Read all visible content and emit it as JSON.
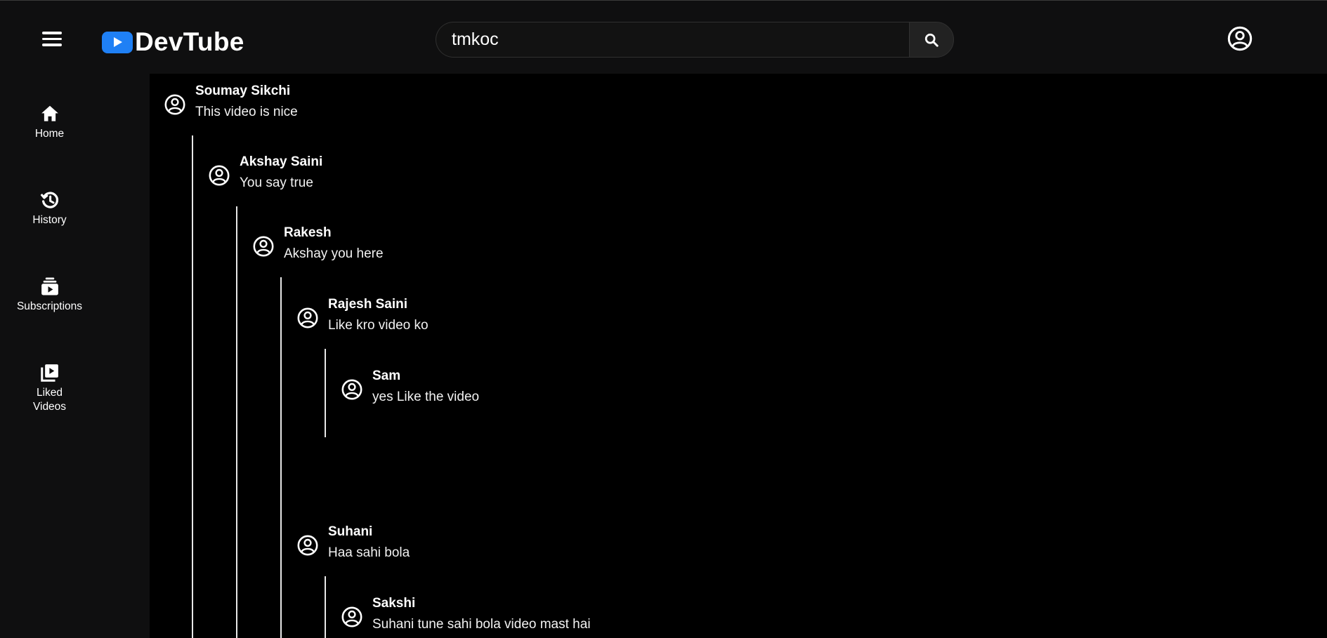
{
  "header": {
    "logo_text": "DevTube",
    "search": {
      "value": "tmkoc",
      "placeholder": "Search"
    }
  },
  "sidebar": {
    "items": [
      {
        "label": "Home",
        "icon": "home-icon"
      },
      {
        "label": "History",
        "icon": "history-icon"
      },
      {
        "label": "Subscriptions",
        "icon": "subscriptions-icon"
      },
      {
        "label": "Liked Videos",
        "icon": "liked-videos-icon"
      }
    ]
  },
  "comments": [
    {
      "name": "Soumay Sikchi",
      "text": "This video is nice",
      "depth": 0
    },
    {
      "name": "Akshay Saini",
      "text": "You say true",
      "depth": 1
    },
    {
      "name": "Rakesh",
      "text": "Akshay you here",
      "depth": 2
    },
    {
      "name": "Rajesh Saini",
      "text": "Like kro video ko",
      "depth": 3
    },
    {
      "name": "Sam",
      "text": "yes Like the video",
      "depth": 4
    },
    {
      "name": "Suhani",
      "text": "Haa sahi bola",
      "depth": 3
    },
    {
      "name": "Sakshi",
      "text": "Suhani tune sahi bola video mast hai",
      "depth": 4
    }
  ],
  "colors": {
    "background": "#000000",
    "header_bg": "#0f0f10",
    "brand": "#1f80f5",
    "text": "#ffffff"
  }
}
